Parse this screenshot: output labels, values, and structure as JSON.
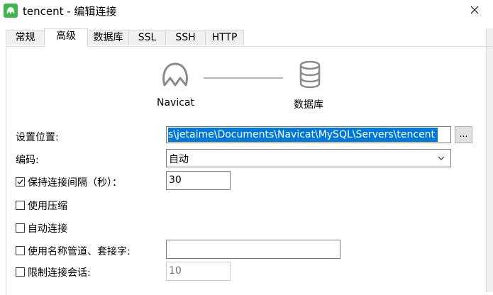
{
  "window": {
    "title": "tencent - 编辑连接"
  },
  "tabs": [
    {
      "label": "常规"
    },
    {
      "label": "高级"
    },
    {
      "label": "数据库"
    },
    {
      "label": "SSL"
    },
    {
      "label": "SSH"
    },
    {
      "label": "HTTP"
    }
  ],
  "diagram": {
    "left_label": "Navicat",
    "right_label": "数据库"
  },
  "form": {
    "location_label": "设置位置:",
    "location_value": "s\\jetaime\\Documents\\Navicat\\MySQL\\Servers\\tencent",
    "browse_label": "...",
    "encoding_label": "编码:",
    "encoding_value": "自动",
    "keepalive_label": "保持连接间隔（秒）：",
    "keepalive_value": "30",
    "keepalive_checked": true,
    "compression_label": "使用压缩",
    "auto_connect_label": "自动连接",
    "named_pipe_label": "使用名称管道、套接字:",
    "named_pipe_value": "",
    "limit_sessions_label": "限制连接会话:",
    "limit_sessions_value": "10"
  }
}
